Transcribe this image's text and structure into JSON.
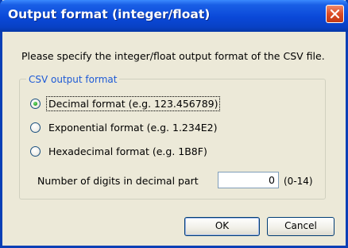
{
  "window": {
    "title": "Output format (integer/float)"
  },
  "prompt": "Please specify the integer/float output format of the CSV file.",
  "group": {
    "legend": "CSV output format",
    "options": [
      {
        "label": "Decimal format (e.g. 123.456789)",
        "selected": true
      },
      {
        "label": "Exponential format (e.g. 1.234E2)",
        "selected": false
      },
      {
        "label": "Hexadecimal format (e.g. 1B8F)",
        "selected": false
      }
    ],
    "digits": {
      "label": "Number of digits in decimal part",
      "value": "0",
      "range": "(0-14)"
    }
  },
  "buttons": {
    "ok": "OK",
    "cancel": "Cancel"
  },
  "colors": {
    "titlebar": "#0a48d8",
    "legend": "#1d5ad6",
    "selected_radio": "#21a121",
    "close_button": "#dc4b24"
  }
}
